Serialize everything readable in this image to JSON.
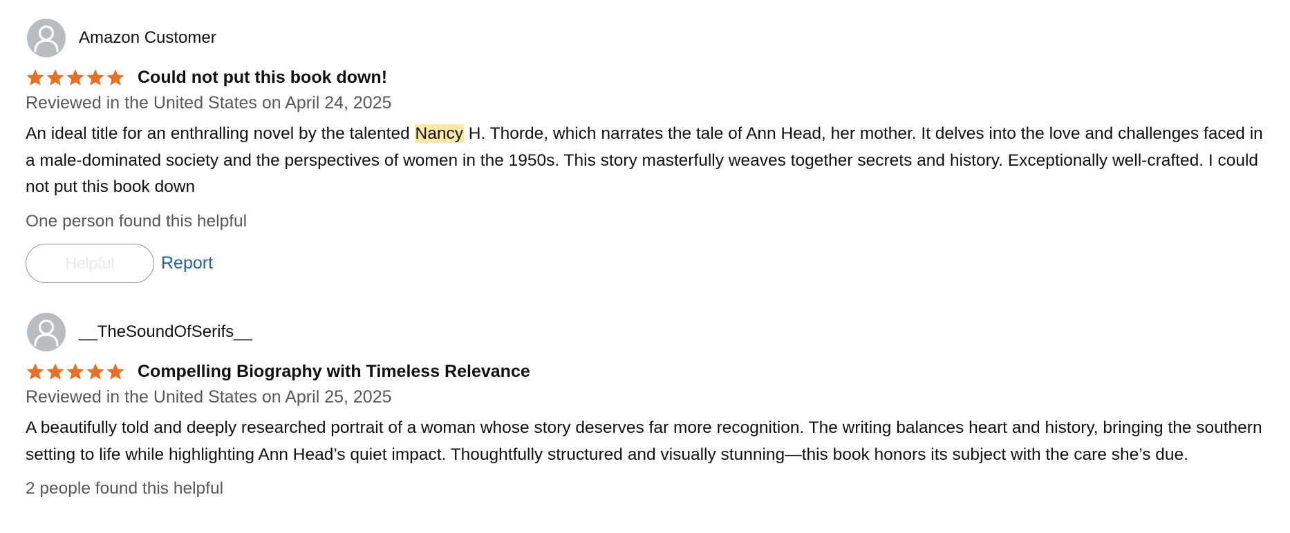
{
  "reviews": [
    {
      "reviewer": "Amazon Customer",
      "rating": 5,
      "rating_max": 5,
      "title": "Could not put this book down!",
      "date": "Reviewed in the United States on April 24, 2025",
      "body_before_highlight": "An ideal title for an enthralling novel by the talented ",
      "body_highlight": "Nancy",
      "body_after_highlight": " H. Thorde, which narrates the tale of Ann Head, her mother. It delves into the love and challenges faced in a male-dominated society and the perspectives of women in the 1950s. This story masterfully weaves together secrets and history. Exceptionally well-crafted. I could not put this book down",
      "helpful_text": "One person found this helpful",
      "helpful_button_label": "Helpful",
      "report_label": "Report"
    },
    {
      "reviewer": "__TheSoundOfSerifs__",
      "rating": 5,
      "rating_max": 5,
      "title": "Compelling Biography with Timeless Relevance",
      "date": "Reviewed in the United States on April 25, 2025",
      "body": "A beautifully told and deeply researched portrait of a woman whose story deserves far more recognition. The writing balances heart and history, bringing the southern setting to life while highlighting Ann Head’s quiet impact. Thoughtfully structured and visually stunning—this book honors its subject with the care she’s due.",
      "helpful_text": "2 people found this helpful"
    }
  ],
  "icons": {
    "avatar": "user-avatar-icon",
    "star": "star-icon"
  },
  "colors": {
    "star": "#e47126",
    "avatar_bg": "#b7bdc0",
    "highlight": "#fde8a7",
    "link": "#2162a1",
    "secondary_text": "#565959"
  }
}
